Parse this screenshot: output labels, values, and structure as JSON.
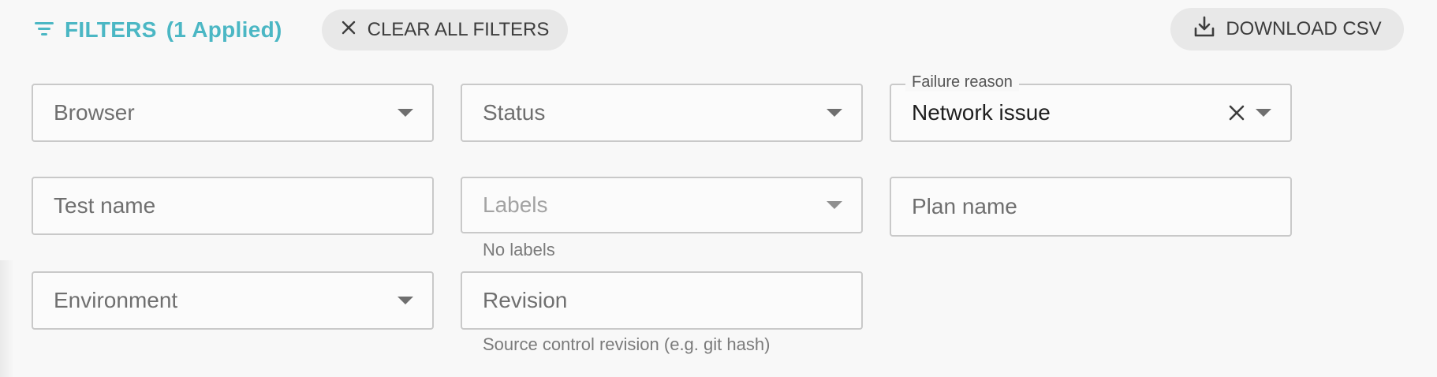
{
  "header": {
    "filters_label": "FILTERS",
    "applied_count": "(1 Applied)",
    "clear_all_label": "CLEAR ALL FILTERS",
    "download_label": "DOWNLOAD CSV",
    "accent_color": "#4bb7c4",
    "icons": {
      "filters": "filter-lines-icon",
      "clear": "close-icon",
      "download": "download-tray-icon"
    }
  },
  "filters": {
    "browser": {
      "placeholder": "Browser",
      "type": "select"
    },
    "status": {
      "placeholder": "Status",
      "type": "select"
    },
    "failure_reason": {
      "label": "Failure reason",
      "value": "Network issue",
      "type": "select"
    },
    "test_name": {
      "placeholder": "Test name",
      "type": "text"
    },
    "labels": {
      "placeholder": "Labels",
      "helper": "No labels",
      "type": "select",
      "disabled": true
    },
    "plan_name": {
      "placeholder": "Plan name",
      "type": "text"
    },
    "environment": {
      "placeholder": "Environment",
      "type": "select"
    },
    "revision": {
      "placeholder": "Revision",
      "helper": "Source control revision (e.g. git hash)",
      "type": "text"
    }
  }
}
